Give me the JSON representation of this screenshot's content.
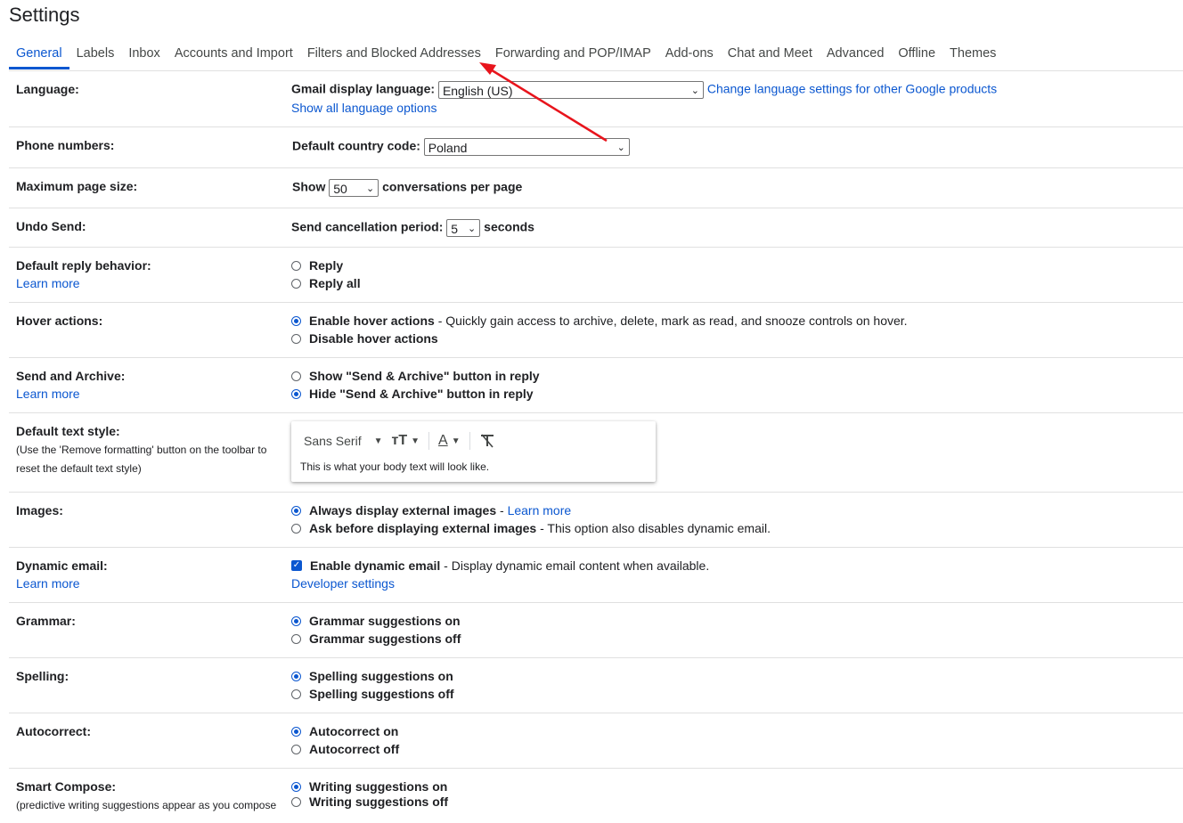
{
  "page": {
    "title": "Settings"
  },
  "tabs": [
    "General",
    "Labels",
    "Inbox",
    "Accounts and Import",
    "Filters and Blocked Addresses",
    "Forwarding and POP/IMAP",
    "Add-ons",
    "Chat and Meet",
    "Advanced",
    "Offline",
    "Themes"
  ],
  "active_tab": "General",
  "learn_more": "Learn more",
  "language": {
    "label": "Language:",
    "display_label": "Gmail display language:",
    "display_value": "English (US)",
    "change_link": "Change language settings for other Google products",
    "show_all_link": "Show all language options"
  },
  "phone": {
    "label": "Phone numbers:",
    "country_label": "Default country code:",
    "country_value": "Poland"
  },
  "page_size": {
    "label": "Maximum page size:",
    "prefix": "Show",
    "value": "50",
    "suffix": "conversations per page"
  },
  "undo_send": {
    "label": "Undo Send:",
    "prefix": "Send cancellation period:",
    "value": "5",
    "suffix": "seconds"
  },
  "reply": {
    "label": "Default reply behavior:",
    "options": [
      "Reply",
      "Reply all"
    ],
    "selected": "none"
  },
  "hover": {
    "label": "Hover actions:",
    "enable": "Enable hover actions",
    "enable_desc": " - Quickly gain access to archive, delete, mark as read, and snooze controls on hover.",
    "disable": "Disable hover actions",
    "selected": "enable"
  },
  "send_archive": {
    "label": "Send and Archive:",
    "show": "Show \"Send & Archive\" button in reply",
    "hide": "Hide \"Send & Archive\" button in reply",
    "selected": "hide"
  },
  "text_style": {
    "label": "Default text style:",
    "note": "(Use the 'Remove formatting' button on the toolbar to reset the default text style)",
    "font": "Sans Serif",
    "preview": "This is what your body text will look like."
  },
  "images": {
    "label": "Images:",
    "always": "Always display external images",
    "always_sep": " - ",
    "always_link": "Learn more",
    "ask": "Ask before displaying external images",
    "ask_desc": " - This option also disables dynamic email.",
    "selected": "always"
  },
  "dynamic": {
    "label": "Dynamic email:",
    "enable": "Enable dynamic email",
    "enable_desc": " - Display dynamic email content when available.",
    "dev_link": "Developer settings",
    "checked": true
  },
  "grammar": {
    "label": "Grammar:",
    "on": "Grammar suggestions on",
    "off": "Grammar suggestions off",
    "selected": "on"
  },
  "spelling": {
    "label": "Spelling:",
    "on": "Spelling suggestions on",
    "off": "Spelling suggestions off",
    "selected": "on"
  },
  "autocorrect": {
    "label": "Autocorrect:",
    "on": "Autocorrect on",
    "off": "Autocorrect off",
    "selected": "on"
  },
  "smart_compose": {
    "label": "Smart Compose:",
    "note": "(predictive writing suggestions appear as you compose",
    "on": "Writing suggestions on",
    "off": "Writing suggestions off",
    "selected": "on"
  },
  "colors": {
    "accent": "#0b57d0",
    "annotation": "#e8141c"
  }
}
